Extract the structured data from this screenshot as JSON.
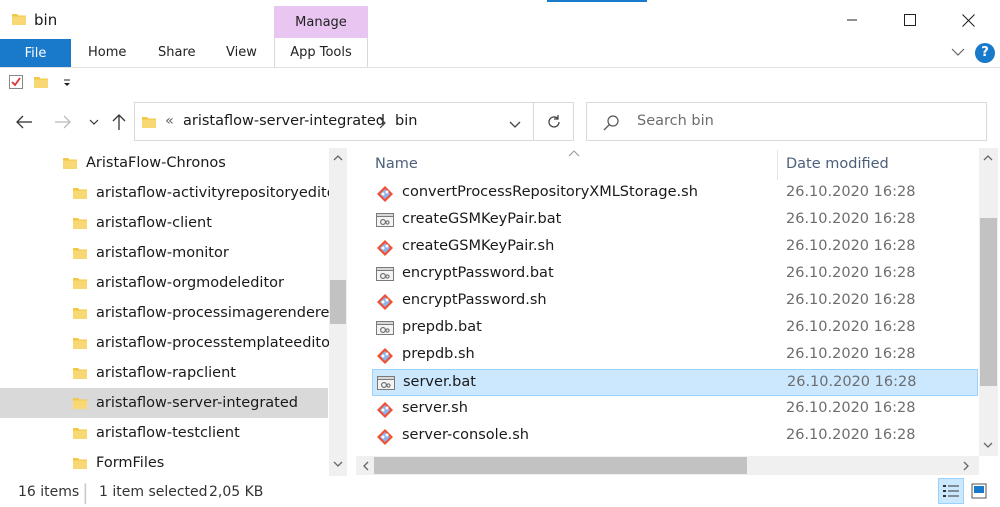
{
  "window": {
    "title": "bin"
  },
  "ribbon": {
    "contextual_group": "Manage",
    "tabs": [
      "File",
      "Home",
      "Share",
      "View",
      "App Tools"
    ]
  },
  "address": {
    "overflow": "«",
    "segments": [
      "aristaflow-server-integrated",
      "bin"
    ],
    "search_placeholder": "Search bin"
  },
  "nav_tree": [
    {
      "label": "AristaFlow-Chronos",
      "level": 0
    },
    {
      "label": "aristaflow-activityrepositoryeditor",
      "level": 1
    },
    {
      "label": "aristaflow-client",
      "level": 1
    },
    {
      "label": "aristaflow-monitor",
      "level": 1
    },
    {
      "label": "aristaflow-orgmodeleditor",
      "level": 1
    },
    {
      "label": "aristaflow-processimagerenderer",
      "level": 1
    },
    {
      "label": "aristaflow-processtemplateeditor",
      "level": 1
    },
    {
      "label": "aristaflow-rapclient",
      "level": 1
    },
    {
      "label": "aristaflow-server-integrated",
      "level": 1,
      "selected": true
    },
    {
      "label": "aristaflow-testclient",
      "level": 1
    },
    {
      "label": "FormFiles",
      "level": 1
    }
  ],
  "columns": {
    "name": "Name",
    "date": "Date modified"
  },
  "files": [
    {
      "name": "convertProcessRepositoryXMLStorage.sh",
      "date": "26.10.2020 16:28",
      "type": "sh"
    },
    {
      "name": "createGSMKeyPair.bat",
      "date": "26.10.2020 16:28",
      "type": "bat"
    },
    {
      "name": "createGSMKeyPair.sh",
      "date": "26.10.2020 16:28",
      "type": "sh"
    },
    {
      "name": "encryptPassword.bat",
      "date": "26.10.2020 16:28",
      "type": "bat"
    },
    {
      "name": "encryptPassword.sh",
      "date": "26.10.2020 16:28",
      "type": "sh"
    },
    {
      "name": "prepdb.bat",
      "date": "26.10.2020 16:28",
      "type": "bat"
    },
    {
      "name": "prepdb.sh",
      "date": "26.10.2020 16:28",
      "type": "sh"
    },
    {
      "name": "server.bat",
      "date": "26.10.2020 16:28",
      "type": "bat",
      "selected": true
    },
    {
      "name": "server.sh",
      "date": "26.10.2020 16:28",
      "type": "sh"
    },
    {
      "name": "server-console.sh",
      "date": "26.10.2020 16:28",
      "type": "sh"
    }
  ],
  "status": {
    "item_count": "16 items",
    "selection": "1 item selected",
    "size": "2,05 KB"
  },
  "colors": {
    "accent": "#1979ca",
    "manage_tab": "#e8c6f1",
    "selected_row": "#cce8ff",
    "folder": "#f3c842"
  },
  "icons": {
    "folder": "folder-icon",
    "bat": "batch-file-icon",
    "sh": "git-shell-script-icon"
  }
}
